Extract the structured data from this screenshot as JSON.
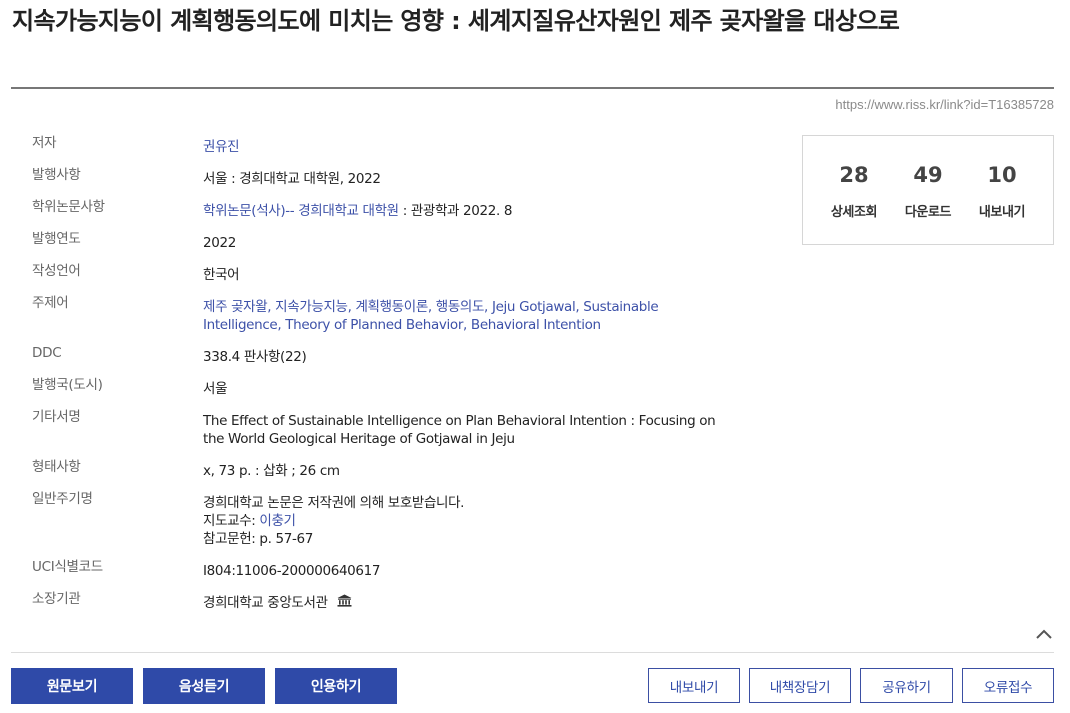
{
  "title": "지속가능지능이 계획행동의도에 미치는 영향 : 세계지질유산자원인 제주 곶자왈을 대상으로",
  "permalink": "https://www.riss.kr/link?id=T16385728",
  "meta": {
    "author": {
      "label": "저자",
      "value": "권유진"
    },
    "publication": {
      "label": "발행사항",
      "value": "서울 : 경희대학교 대학원, 2022"
    },
    "degree": {
      "label": "학위논문사항",
      "link": "학위논문(석사)-- 경희대학교 대학원",
      "rest": " : 관광학과 2022. 8"
    },
    "year": {
      "label": "발행연도",
      "value": "2022"
    },
    "language": {
      "label": "작성언어",
      "value": "한국어"
    },
    "subject": {
      "label": "주제어",
      "line1": "제주 곶자왈, 지속가능지능, 계획행동이론, 행동의도, Jeju Gotjawal, Sustainable",
      "line2": "Intelligence, Theory of Planned Behavior, Behavioral Intention"
    },
    "ddc": {
      "label": "DDC",
      "value": "338.4 판사항(22)"
    },
    "country": {
      "label": "발행국(도시)",
      "value": "서울"
    },
    "alt_title": {
      "label": "기타서명",
      "line1": "The Effect of Sustainable Intelligence on Plan Behavioral Intention : Focusing on",
      "line2": "the World Geological Heritage of Gotjawal in Jeju"
    },
    "format": {
      "label": "형태사항",
      "value": "x, 73 p. : 삽화 ; 26 cm"
    },
    "notes": {
      "label": "일반주기명",
      "line1": "경희대학교 논문은 저작권에 의해 보호받습니다.",
      "advisor_prefix": "지도교수: ",
      "advisor": "이충기",
      "line3": "참고문헌: p. 57-67"
    },
    "uci": {
      "label": "UCI식별코드",
      "value": "I804:11006-200000640617"
    },
    "holding": {
      "label": "소장기관",
      "value": "경희대학교 중앙도서관"
    }
  },
  "stats": [
    {
      "value": "28",
      "label": "상세조회"
    },
    {
      "value": "49",
      "label": "다운로드"
    },
    {
      "value": "10",
      "label": "내보내기"
    }
  ],
  "actions": {
    "primary": [
      "원문보기",
      "음성듣기",
      "인용하기"
    ],
    "secondary": [
      "내보내기",
      "내책장담기",
      "공유하기",
      "오류접수"
    ]
  },
  "colors": {
    "accent": "#2f4aa8",
    "link": "#3d51a8"
  },
  "icons": {
    "library": "library-building-icon",
    "scroll_top": "chevron-up-icon"
  }
}
